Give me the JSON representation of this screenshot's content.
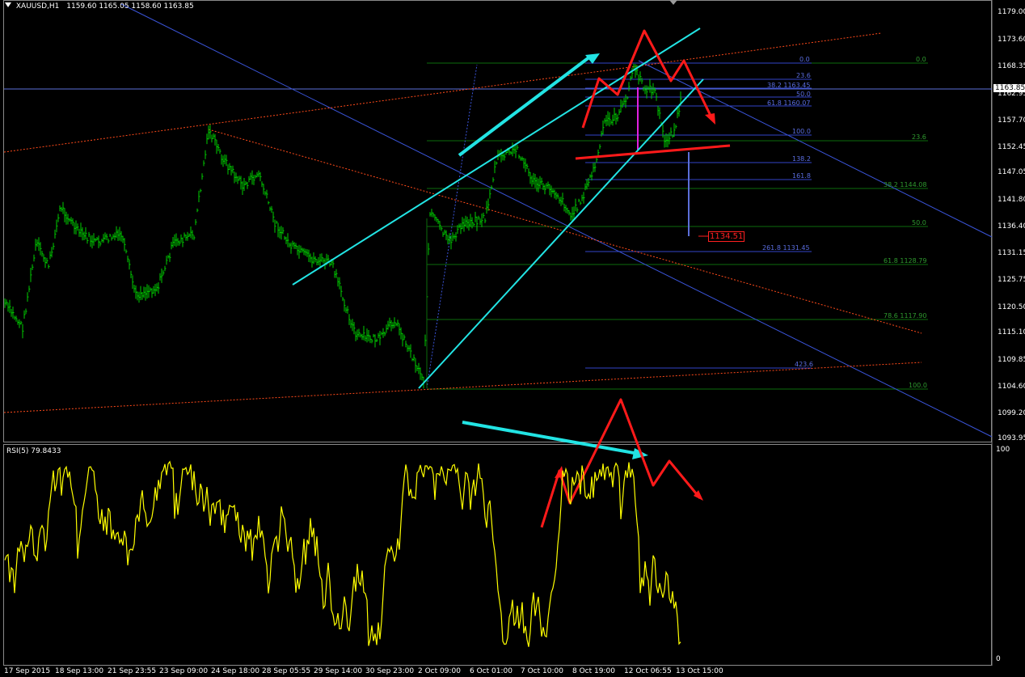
{
  "header": {
    "symbol": "XAUUSD,H1",
    "ohlc": "1159.60 1165.05 1158.60 1163.85"
  },
  "rsi": {
    "label": "RSI(5) 79.8433",
    "scale_top": "100",
    "scale_bottom": "0"
  },
  "price_axis": [
    "1179.00",
    "1173.60",
    "1168.35",
    "1162.95",
    "1157.70",
    "1152.45",
    "1147.05",
    "1141.80",
    "1136.40",
    "1131.15",
    "1125.75",
    "1120.50",
    "1115.10",
    "1109.85",
    "1104.60",
    "1099.20",
    "1093.95"
  ],
  "current_price": "1163.85",
  "time_axis": [
    "17 Sep 2015",
    "18 Sep 13:00",
    "21 Sep 23:55",
    "23 Sep 09:00",
    "24 Sep 18:00",
    "28 Sep 05:55",
    "29 Sep 14:00",
    "30 Sep 23:00",
    "2 Oct 09:00",
    "6 Oct 01:00",
    "7 Oct 10:00",
    "8 Oct 19:00",
    "12 Oct 06:55",
    "13 Oct 15:00"
  ],
  "fib_labels": {
    "right_set": [
      "0.0",
      "23.6",
      "38.2 1144.08",
      "50.0",
      "61.8 1128.79",
      "78.6 1117.90",
      "100.0"
    ],
    "mid_set": [
      "0.0",
      "23.6",
      "38.2 1163.45",
      "50.0",
      "61.8 1160.07",
      "100.0",
      "138.2",
      "161.8",
      "261.8 1131.45",
      "423.6"
    ]
  },
  "target_label": "1134.51",
  "colors": {
    "background": "#000000",
    "candles": "#00cc00",
    "rsi_line": "#ffff00",
    "cyan": "#22e4e4",
    "red": "#ff1a1a",
    "blue_line": "#3a54d8",
    "dotted_red": "#ff4a1a",
    "fib_green": "#0b6b0b",
    "fib_blue": "#3245c8"
  },
  "icons": {
    "header_dropdown": "triangle-down-icon",
    "scroll_marker": "chart-shift-marker-icon"
  }
}
